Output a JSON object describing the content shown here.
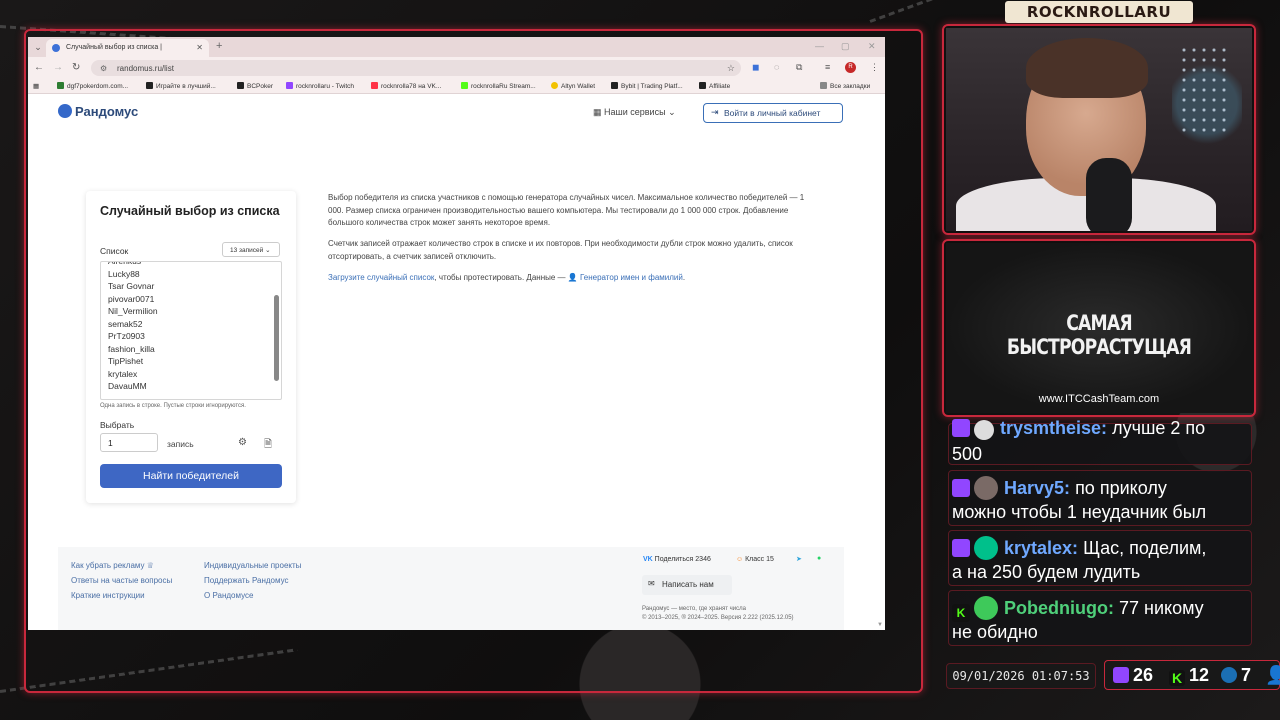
{
  "browser": {
    "tab_title": "Случайный выбор из списка |",
    "tab_close": "✕",
    "new_tab": "+",
    "url": "randomus.ru/list",
    "bookmarks": [
      {
        "label": "dgf7pokerdom.com...",
        "color": "#2e7d32"
      },
      {
        "label": "Играйте в лучший...",
        "color": "#222222"
      },
      {
        "label": "BCPoker",
        "color": "#222222"
      },
      {
        "label": "rocknrollaru - Twitch",
        "color": "#9146ff"
      },
      {
        "label": "rocknrolla78 на VK...",
        "color": "#ff3347"
      },
      {
        "label": "rocknrollaRu Stream...",
        "color": "#53fc18"
      },
      {
        "label": "Altyn Wallet",
        "color": "#f2c200"
      },
      {
        "label": "Bybit | Trading Platf...",
        "color": "#222222"
      },
      {
        "label": "Affiliate",
        "color": "#222222"
      }
    ],
    "all_bookmarks": "Все закладки"
  },
  "site": {
    "logo": "Рандомус",
    "services": "Наши сервисы",
    "login": "Войти в личный кабинет"
  },
  "form": {
    "title": "Случайный выбор из списка",
    "list_label": "Список",
    "count_select": "13 записей",
    "entries": [
      "Alrenkus",
      "Lucky88",
      "Tsar Govnar",
      "pivovar0071",
      "Nil_Vermilion",
      "semak52",
      "PrTz0903",
      "fashion_killa",
      "TipPishet",
      "krytalex",
      "DavauMM"
    ],
    "hint": "Одна запись в строке. Пустые строки игнорируются.",
    "pick_label": "Выбрать",
    "pick_value": "1",
    "pick_unit": "запись",
    "find_button": "Найти победителей"
  },
  "description": {
    "p1": "Выбор победителя из списка участников с помощью генератора случайных чисел. Максимальное количество победителей — 1 000. Размер списка ограничен производительностью вашего компьютера. Мы тестировали до 1 000 000 строк. Добавление большого количества строк может занять некоторое время.",
    "p2": "Счетчик записей отражает количество строк в списке и их повторов. При необходимости дубли строк можно удалить, список отсортировать, а счетчик записей отключить.",
    "link1": "Загрузите случайный список",
    "mid": ", чтобы протестировать. Данные —",
    "link2": "Генератор имен и фамилий",
    "end": "."
  },
  "footer": {
    "col1": [
      "Как убрать рекламу ♕",
      "Ответы на частые вопросы",
      "Краткие инструкции"
    ],
    "col2": [
      "Индивидуальные проекты",
      "Поддержать Рандомус",
      "О Рандомусе"
    ],
    "vk_share": "Поделиться",
    "vk_count": "2346",
    "ok_label": "Класс",
    "ok_count": "15",
    "write_us": "Написать нам",
    "tagline": "Рандомус — место, где хранят числа",
    "copyright": "© 2013–2025, ® 2024–2025. Версия 2.222 (2025.12.05)"
  },
  "stream": {
    "channel": "ROCKNROLLARU",
    "ad_title": "САМАЯ БЫСТРОРАСТУЩАЯ",
    "ad_url": "www.ITCCashTeam.com",
    "chat": [
      {
        "user": "trysmtheise:",
        "lines": [
          "лучше 2 по",
          "500"
        ],
        "badge": "twitch"
      },
      {
        "user": "Harvy5:",
        "lines": [
          "по приколу",
          "можно чтобы 1 неудачник был"
        ],
        "badge": "twitch"
      },
      {
        "user": "krytalex:",
        "lines": [
          "Щас, поделим,",
          "а на 250 будем лудить"
        ],
        "badge": "twitch"
      },
      {
        "user": "Pobedniugo:",
        "lines": [
          "77 никому",
          "не обидно"
        ],
        "badge": "kick"
      }
    ],
    "datetime": "09/01/2026 01:07:53",
    "twitch_viewers": "26",
    "kick_viewers": "12",
    "steam_viewers": "7"
  }
}
